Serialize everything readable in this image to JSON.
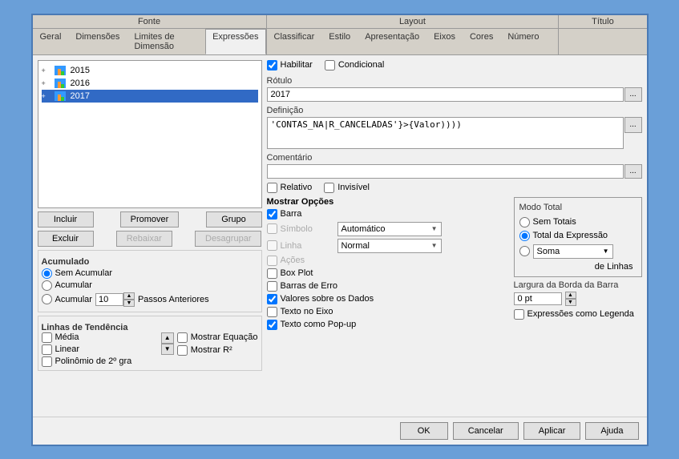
{
  "dialog": {
    "tab_groups": [
      {
        "label": "Fonte",
        "tabs": [
          "Geral",
          "Dimensões",
          "Limites de Dimensão",
          "Expressões"
        ]
      },
      {
        "label": "Layout",
        "tabs": [
          "Classificar",
          "Estilo",
          "Apresentação",
          "Eixos",
          "Cores",
          "Número"
        ]
      },
      {
        "label": "Título",
        "tabs": []
      }
    ],
    "active_tab": "Expressões"
  },
  "left_panel": {
    "tree_items": [
      {
        "label": "2015",
        "level": 1
      },
      {
        "label": "2016",
        "level": 1
      },
      {
        "label": "2017",
        "level": 1,
        "selected": true
      }
    ],
    "buttons": {
      "incluir": "Incluir",
      "promover": "Promover",
      "grupo": "Grupo",
      "excluir": "Excluir",
      "rebaixar": "Rebaixar",
      "desagrupar": "Desagrupar"
    },
    "acumulado": {
      "label": "Acumulado",
      "options": [
        "Sem Acumular",
        "Acumular",
        "Acumular"
      ],
      "selected": 0,
      "spinner_value": "10",
      "passos_label": "Passos Anteriores"
    },
    "tendencia": {
      "label": "Linhas de Tendência",
      "items": [
        "Média",
        "Linear",
        "Polinômio de 2º gra"
      ],
      "mostrar_equacao": "Mostrar Equação",
      "mostrar_r2": "Mostrar R²"
    }
  },
  "right_panel": {
    "habilitar_label": "Habilitar",
    "condicional_label": "Condicional",
    "rotulo_label": "Rótulo",
    "rotulo_value": "2017",
    "definicao_label": "Definição",
    "definicao_value": "'CONTAS_NA|R_CANCELADAS'}>{Valor))))",
    "comentario_label": "Comentário",
    "comentario_value": "",
    "relativo_label": "Relativo",
    "invisivel_label": "Invisível",
    "mostrar_opcoes": {
      "label": "Mostrar Opções",
      "barra": "Barra",
      "simbolo": "Símbolo",
      "simbolo_dropdown": "Automático",
      "linha": "Linha",
      "linha_dropdown": "Normal",
      "acoes": "Ações",
      "box_plot": "Box Plot",
      "barras_erro": "Barras de Erro",
      "valores_sobre_dados": "Valores sobre os Dados",
      "texto_no_eixo": "Texto no Eixo",
      "texto_como_popup": "Texto como Pop-up"
    },
    "modo_total": {
      "label": "Modo Total",
      "sem_totais": "Sem Totais",
      "total_expressao": "Total da Expressão",
      "soma": "Soma",
      "de_linhas": "de Linhas"
    },
    "largura": {
      "label": "Largura da Borda da Barra",
      "value": "0 pt"
    },
    "expressoes_legenda": "Expressões como Legenda"
  },
  "footer": {
    "ok": "OK",
    "cancelar": "Cancelar",
    "aplicar": "Aplicar",
    "ajuda": "Ajuda"
  },
  "checkboxes": {
    "habilitar": true,
    "condicional": false,
    "relativo": false,
    "invisivel": false,
    "barra": true,
    "simbolo": false,
    "linha": false,
    "acoes": false,
    "box_plot": false,
    "barras_erro": false,
    "valores_sobre_dados": true,
    "texto_no_eixo": false,
    "texto_como_popup": true,
    "mostrar_equacao": false,
    "mostrar_r2": false,
    "expressoes_legenda": false
  },
  "radio": {
    "sem_acumular": true,
    "acumular1": false,
    "acumular2": false,
    "sem_totais": false,
    "total_expressao": true,
    "soma": false
  }
}
